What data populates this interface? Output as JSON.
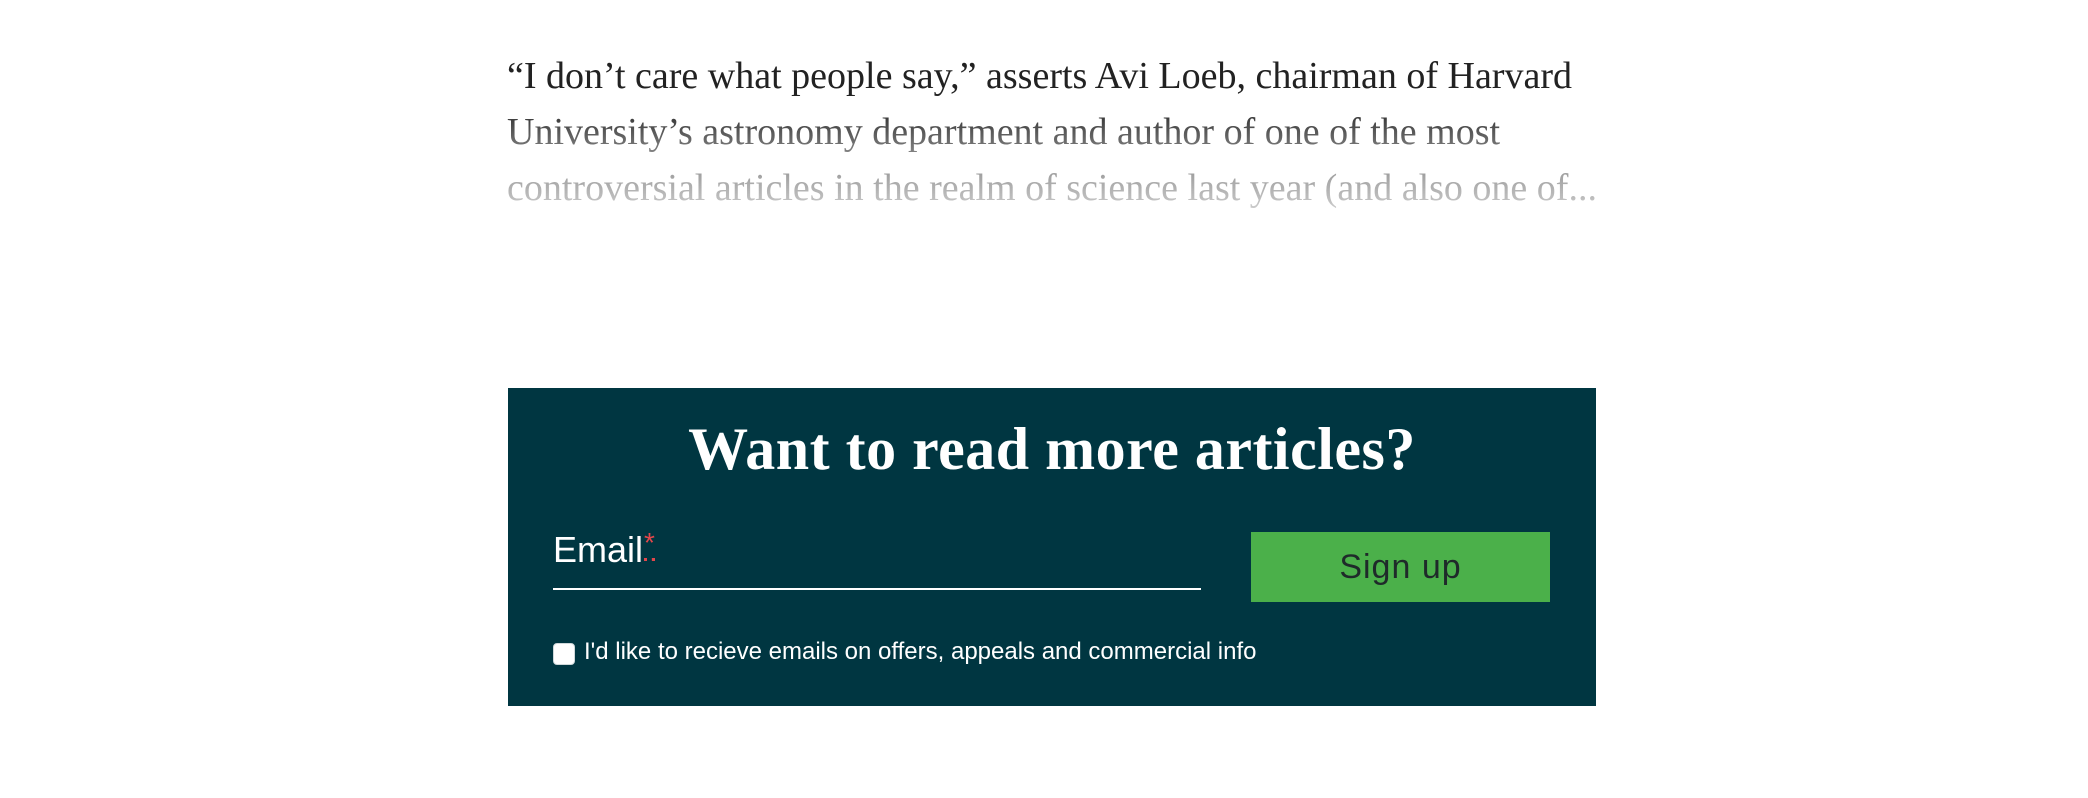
{
  "article": {
    "excerpt": "“I don’t care what people say,” asserts Avi Loeb, chairman of Harvard University’s astronomy department and author of one of the most controversial articles in the realm of science last year (and also one of..."
  },
  "signup": {
    "title": "Want to read more articles?",
    "email_label": "Email",
    "required_marker": "*",
    "email_value": "",
    "button_label": "Sign up",
    "consent_label": "I'd like to recieve emails on offers, appeals and commercial info",
    "consent_checked": false
  },
  "colors": {
    "panel_background": "#003641",
    "button_background": "#4bb04a",
    "required_marker": "#e2474b"
  }
}
